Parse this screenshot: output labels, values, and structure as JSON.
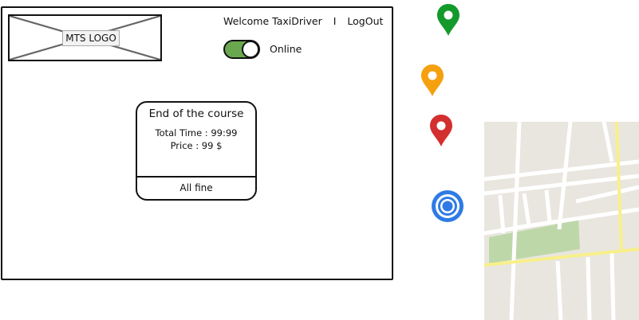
{
  "logo": {
    "label": "MTS LOGO"
  },
  "header": {
    "welcome": "Welcome TaxiDriver",
    "separator": "I",
    "logout": "LogOut"
  },
  "status": {
    "label": "Online",
    "on": true
  },
  "course_card": {
    "title": "End of the course",
    "total_time": "Total Time :  99:99",
    "price": "Price : 99 $",
    "action": "All fine"
  },
  "markers": [
    "map-pin-green",
    "map-pin-orange",
    "map-pin-red",
    "my-location-icon"
  ],
  "colors": {
    "toggle_on": "#6aa84f",
    "pin_green": "#139a2b",
    "pin_orange": "#f5a00f",
    "pin_red": "#d32f2f",
    "locate_blue": "#2f7be5",
    "map_bg": "#e9e6df",
    "map_park": "#bed7a8",
    "map_main_road": "#f8f08a"
  }
}
